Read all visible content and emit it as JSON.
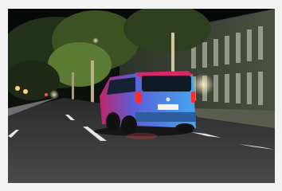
{
  "photo": {
    "subject": "night-street-scene",
    "license_plate_text": "",
    "colors": {
      "sky": "#07090a",
      "road": "#3a3a3c",
      "van_body": "#3f7fe0",
      "van_roof": "#d9246e",
      "trees": "#4e6a2c",
      "building": "#3e4437",
      "street_light": "#f7e7a6"
    }
  }
}
